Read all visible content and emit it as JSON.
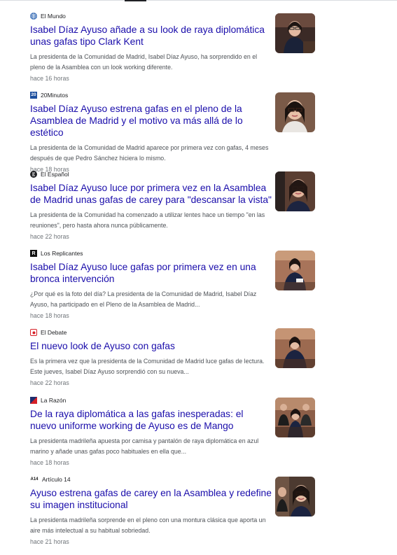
{
  "news": [
    {
      "source": "El Mundo",
      "logo_icon": "el-mundo-globe-icon",
      "title": "Isabel Díaz Ayuso añade a su look de raya diplomática unas gafas tipo Clark Kent",
      "snippet": "La presidenta de la Comunidad de Madrid, Isabel Díaz Ayuso, ha sorprendido en el pleno de la Asamblea con un look working diferente.",
      "time": "hace 16 horas"
    },
    {
      "source": "20Minutos",
      "logo_icon": "20minutos-logo-icon",
      "title": "Isabel Díaz Ayuso estrena gafas en el pleno de la Asamblea de Madrid y el motivo va más allá de lo estético",
      "snippet": "La presidenta de la Comunidad de Madrid aparece por primera vez con gafas, 4 meses después de que Pedro Sánchez hiciera lo mismo.",
      "time": "hace 18 horas"
    },
    {
      "source": "El Español",
      "logo_icon": "el-espanol-logo-icon",
      "title": "Isabel Díaz Ayuso luce por primera vez en la Asamblea de Madrid unas gafas de carey para \"descansar la vista\"",
      "snippet": "La presidenta de la Comunidad ha comenzado a utilizar lentes hace un tiempo \"en las reuniones\", pero hasta ahora nunca públicamente.",
      "time": "hace 22 horas"
    },
    {
      "source": "Los Replicantes",
      "logo_icon": "los-replicantes-logo-icon",
      "title": "Isabel Díaz Ayuso luce gafas por primera vez en una bronca intervención",
      "snippet": "¿Por qué es la foto del día? La presidenta de la Comunidad de Madrid, Isabel Díaz Ayuso, ha participado en el Pleno de la Asamblea de Madrid...",
      "time": "hace 18 horas"
    },
    {
      "source": "El Debate",
      "logo_icon": "el-debate-logo-icon",
      "title": "El nuevo look de Ayuso con gafas",
      "snippet": "Es la primera vez que la presidenta de la Comunidad de Madrid luce gafas de lectura. Este jueves, Isabel Díaz Ayuso sorprendió con su nueva...",
      "time": "hace 22 horas"
    },
    {
      "source": "La Razón",
      "logo_icon": "la-razon-logo-icon",
      "title": "De la raya diplomática a las gafas inesperadas: el nuevo uniforme working de Ayuso es de Mango",
      "snippet": "La presidenta madrileña apuesta por camisa y pantalón de raya diplomática en azul marino y añade unas gafas poco habituales en ella que...",
      "time": "hace 18 horas"
    },
    {
      "source": "Artículo 14",
      "logo_icon": "articulo-14-logo-icon",
      "title": "Ayuso estrena gafas de carey en la Asamblea y redefine su imagen institucional",
      "snippet": "La presidenta madrileña sorprende en el pleno con una montura clásica que aporta un aire más intelectual a su habitual sobriedad.",
      "time": "hace 21 horas"
    }
  ],
  "colors": {
    "headline": "#1a0dab",
    "snippet": "#4d5156",
    "time": "#70757a"
  }
}
